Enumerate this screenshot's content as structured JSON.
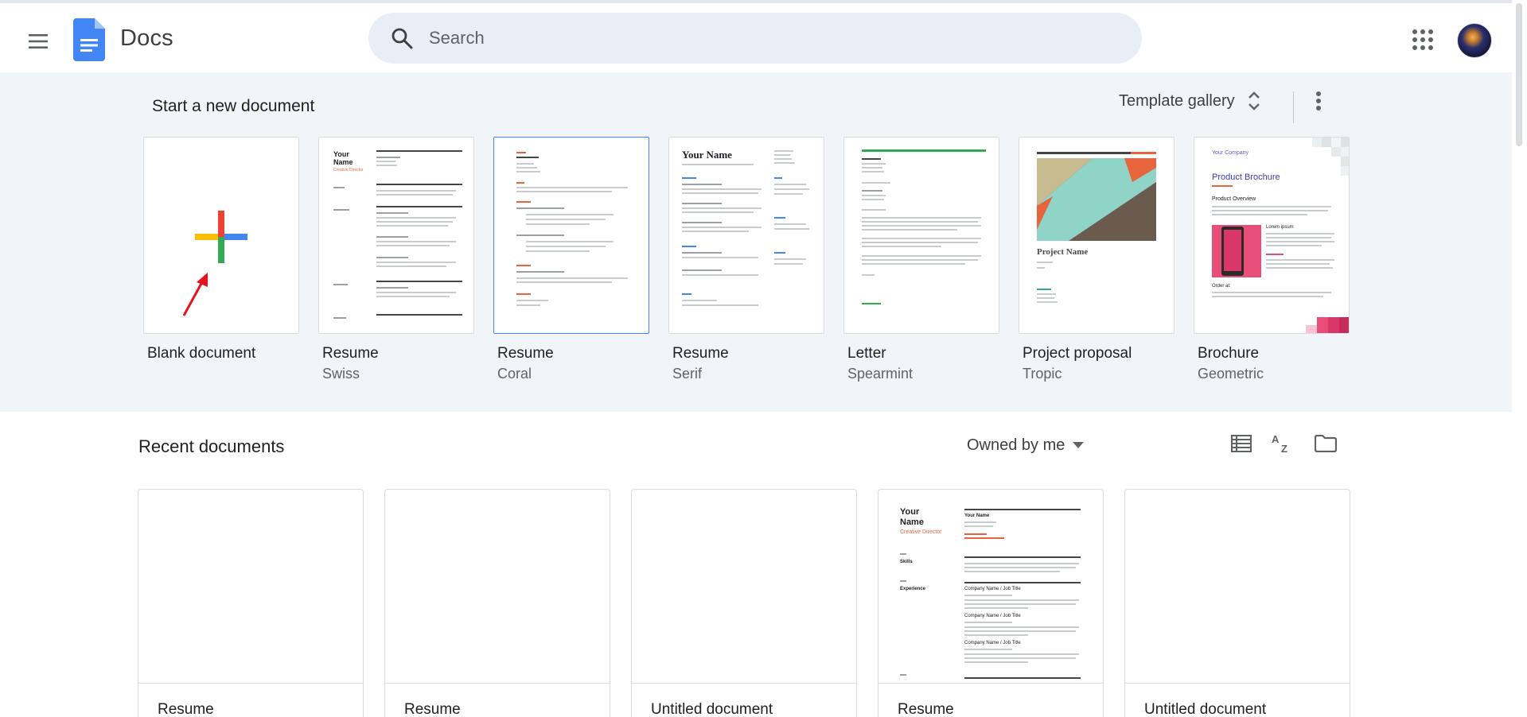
{
  "header": {
    "app_name": "Docs",
    "search_placeholder": "Search"
  },
  "templates": {
    "section_title": "Start a new document",
    "gallery_label": "Template gallery",
    "items": [
      {
        "name": "Blank document",
        "subtitle": ""
      },
      {
        "name": "Resume",
        "subtitle": "Swiss"
      },
      {
        "name": "Resume",
        "subtitle": "Coral"
      },
      {
        "name": "Resume",
        "subtitle": "Serif"
      },
      {
        "name": "Letter",
        "subtitle": "Spearmint"
      },
      {
        "name": "Project proposal",
        "subtitle": "Tropic"
      },
      {
        "name": "Brochure",
        "subtitle": "Geometric"
      }
    ],
    "thumb_text": {
      "swiss_name": "Your\nName",
      "swiss_role": "Creative Director",
      "serif_name": "Your Name",
      "project_name": "Project Name",
      "brochure_company": "Your Company",
      "brochure_title": "Product Brochure",
      "brochure_overview": "Product Overview",
      "brochure_lorem": "Lorem ipsum",
      "brochure_order": "Order at:"
    }
  },
  "recent": {
    "section_title": "Recent documents",
    "filter_label": "Owned by me",
    "docs": [
      {
        "title": "Resume"
      },
      {
        "title": "Resume"
      },
      {
        "title": "Untitled document"
      },
      {
        "title": "Resume"
      },
      {
        "title": "Untitled document"
      }
    ],
    "preview_text": {
      "name": "Your\nName",
      "role": "Creative Director",
      "skills": "Skills",
      "experience": "Experience",
      "right_name": "Your Name",
      "company1": "Company Name / Job Title",
      "company2": "Company Name / Job Title",
      "company3": "Company Name / Job Title"
    }
  },
  "colors": {
    "accent_blue": "#4285f4",
    "google_red": "#ea4335",
    "google_yellow": "#fbbc04",
    "google_green": "#34a853",
    "coral": "#e8643c",
    "spearmint": "#34a853",
    "surface": "#f1f4f9"
  },
  "icons": {
    "menu": "menu-icon",
    "logo": "docs-logo-icon",
    "search": "search-icon",
    "apps": "apps-grid-icon",
    "gallery_toggle": "unfold-more-icon",
    "more": "more-vert-icon",
    "dropdown": "arrow-drop-down-icon",
    "list_view": "list-view-icon",
    "sort": "sort-az-icon",
    "folder": "folder-icon",
    "blank_plus": "plus-icon"
  }
}
